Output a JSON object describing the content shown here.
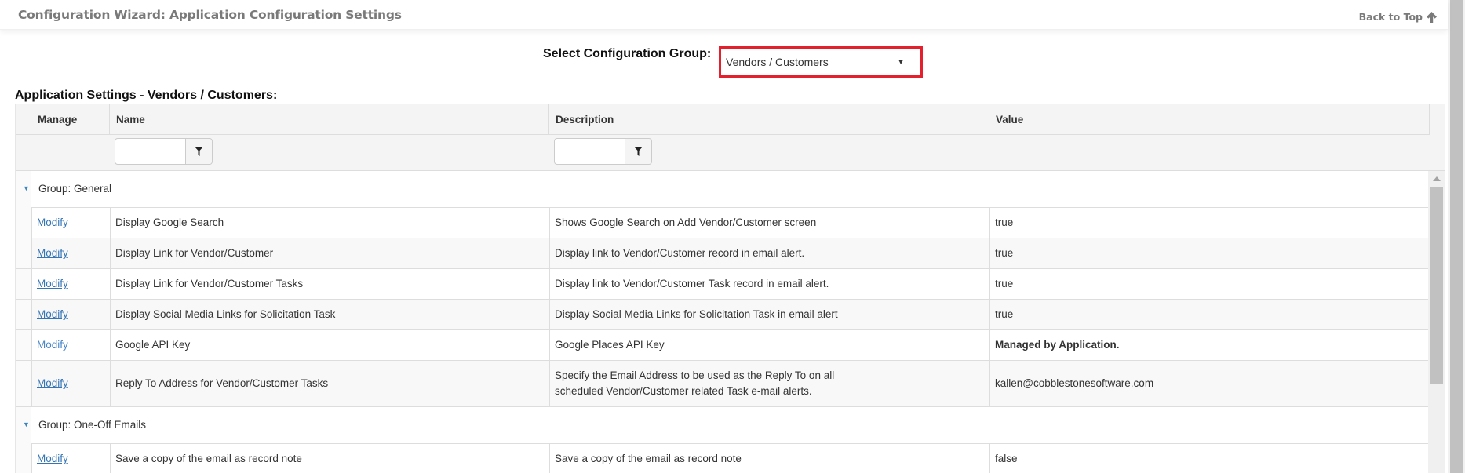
{
  "header": {
    "title": "Configuration Wizard: Application Configuration Settings",
    "back_to_top": "Back to Top",
    "back_to_top_icon": "arrow-up-icon"
  },
  "group_selector": {
    "label": "Select Configuration Group:",
    "selected": "Vendors / Customers",
    "highlight_color": "#e3202b"
  },
  "section_heading": "Application Settings - Vendors / Customers:",
  "grid": {
    "columns": [
      "Manage",
      "Name",
      "Description",
      "Value"
    ],
    "filters": {
      "name": {
        "value": "",
        "icon": "filter-icon"
      },
      "description": {
        "value": "",
        "icon": "filter-icon"
      }
    },
    "groups": [
      {
        "label": "Group: General",
        "rows": [
          {
            "manage": "Modify",
            "name": "Display Google Search",
            "description": "Shows Google Search on Add Vendor/Customer screen",
            "value": "true"
          },
          {
            "manage": "Modify",
            "name": "Display Link for Vendor/Customer",
            "description": "Display link to Vendor/Customer record in email alert.",
            "value": "true"
          },
          {
            "manage": "Modify",
            "name": "Display Link for Vendor/Customer Tasks",
            "description": "Display link to Vendor/Customer Task record in email alert.",
            "value": "true"
          },
          {
            "manage": "Modify",
            "name": "Display Social Media Links for Solicitation Task",
            "description": "Display Social Media Links for Solicitation Task in email alert",
            "value": "true"
          },
          {
            "manage": "Modify",
            "name": "Google API Key",
            "description": "Google Places API Key",
            "value": "Managed by Application."
          },
          {
            "manage": "Modify",
            "name": "Reply To Address for Vendor/Customer Tasks",
            "description": "Specify the Email Address to be used as the Reply To on all scheduled Vendor/Customer related Task e-mail alerts.",
            "value": "kallen@cobblestonesoftware.com"
          }
        ]
      },
      {
        "label": "Group: One-Off Emails",
        "rows": [
          {
            "manage": "Modify",
            "name": "Save a copy of the email as record note",
            "description": "Save a copy of the email as record note",
            "value": "false"
          }
        ]
      }
    ]
  }
}
